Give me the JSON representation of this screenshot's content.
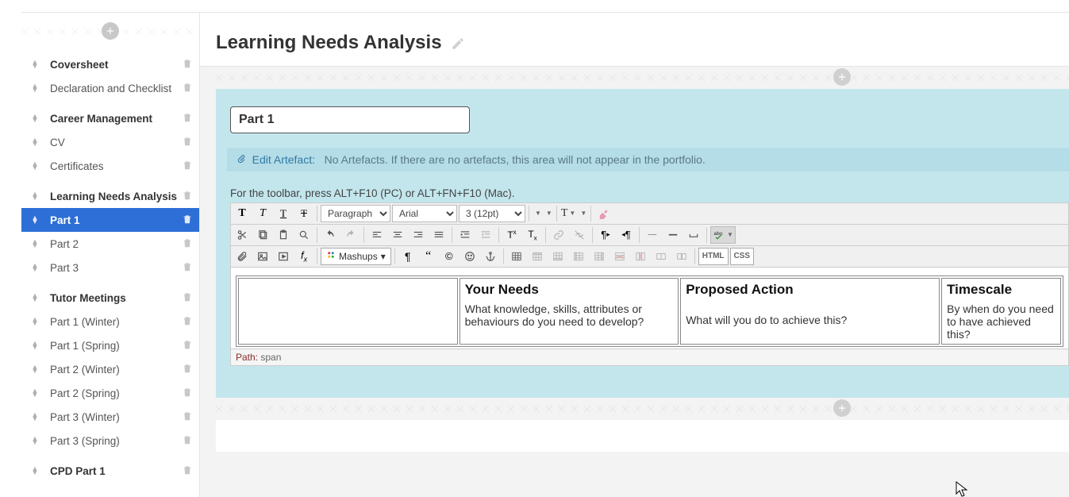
{
  "page": {
    "title": "Learning Needs Analysis"
  },
  "sidebar": {
    "groups": [
      {
        "items": [
          {
            "label": "Coversheet",
            "section": true
          },
          {
            "label": "Declaration and Checklist"
          }
        ]
      },
      {
        "items": [
          {
            "label": "Career Management",
            "section": true
          },
          {
            "label": "CV"
          },
          {
            "label": "Certificates"
          }
        ]
      },
      {
        "items": [
          {
            "label": "Learning Needs Analysis",
            "section": true
          },
          {
            "label": "Part 1",
            "active": true
          },
          {
            "label": "Part 2"
          },
          {
            "label": "Part 3"
          }
        ]
      },
      {
        "items": [
          {
            "label": "Tutor Meetings",
            "section": true
          },
          {
            "label": "Part 1 (Winter)"
          },
          {
            "label": "Part 1 (Spring)"
          },
          {
            "label": "Part 2 (Winter)"
          },
          {
            "label": "Part 2 (Spring)"
          },
          {
            "label": "Part 3 (Winter)"
          },
          {
            "label": "Part 3 (Spring)"
          }
        ]
      },
      {
        "items": [
          {
            "label": "CPD Part 1",
            "section": true
          }
        ]
      }
    ]
  },
  "part_title": "Part 1",
  "artefact": {
    "link": "Edit Artefact:",
    "msg": "No Artefacts. If there are no artefacts, this area will not appear in the portfolio."
  },
  "toolbar_hint": "For the toolbar, press ALT+F10 (PC) or ALT+FN+F10 (Mac).",
  "editor": {
    "format": "Paragraph",
    "font": "Arial",
    "size": "3 (12pt)",
    "mashups": "Mashups",
    "html_btn": "HTML",
    "css_btn": "CSS"
  },
  "table": {
    "headers": [
      "",
      "Your Needs",
      "Proposed Action",
      "Timescale"
    ],
    "subs": [
      "",
      "What knowledge, skills, attributes or behaviours do you need to develop?",
      "What will you do to achieve this?",
      "By when do you need to have achieved this?"
    ]
  },
  "path": {
    "label": "Path:",
    "value": "span"
  }
}
